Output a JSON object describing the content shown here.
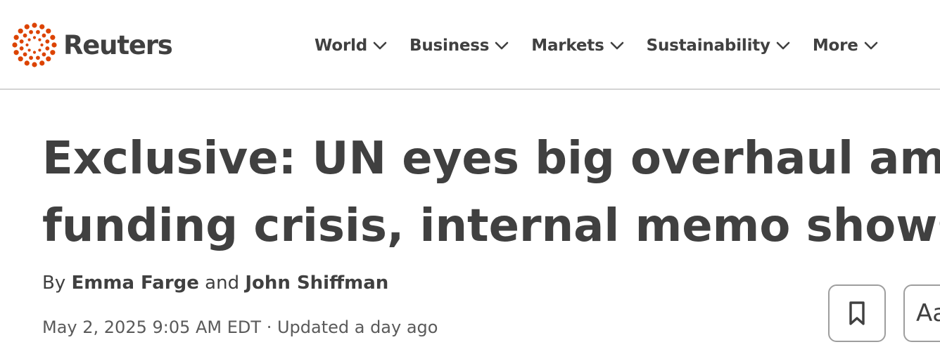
{
  "header": {
    "logo_text": "Reuters",
    "brand_color": "#dc4300",
    "nav": [
      {
        "label": "World",
        "icon": "chevron-down-icon"
      },
      {
        "label": "Business",
        "icon": "chevron-down-icon"
      },
      {
        "label": "Markets",
        "icon": "chevron-down-icon"
      },
      {
        "label": "Sustainability",
        "icon": "chevron-down-icon"
      },
      {
        "label": "More",
        "icon": "chevron-down-icon"
      }
    ]
  },
  "article": {
    "headline_line1": "Exclusive: UN eyes big overhaul amid",
    "headline_line2": "funding crisis, internal memo shows",
    "byline_prefix": "By",
    "author1": "Emma Farge",
    "byline_and": "and",
    "author2": "John Shiffman",
    "dateline": "May 2, 2025 9:05 AM EDT · Updated a day ago"
  },
  "actions": {
    "bookmark_icon": "bookmark-icon",
    "text_size_label": "Aa"
  }
}
